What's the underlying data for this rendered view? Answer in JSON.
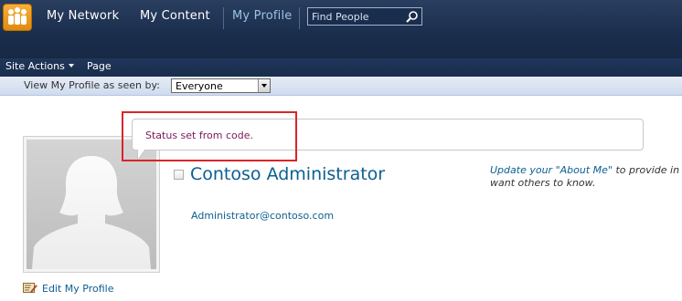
{
  "topnav": {
    "links": [
      {
        "label": "My Network"
      },
      {
        "label": "My Content"
      },
      {
        "label": "My Profile",
        "active": true
      }
    ],
    "search_placeholder": "Find People"
  },
  "ribbon": {
    "site_actions": "Site Actions",
    "page": "Page"
  },
  "view_as": {
    "label": "View My Profile as seen by:",
    "selected": "Everyone"
  },
  "status": {
    "text": "Status set from code."
  },
  "profile": {
    "name": "Contoso Administrator",
    "email": "Administrator@contoso.com",
    "about_link": "Update your \"About Me\"",
    "about_rest": " to provide in",
    "about_line2": "want others to know.",
    "edit_label": "Edit My Profile"
  },
  "colors": {
    "nav_background": "#1a2d4c",
    "link_blue": "#0b5f91",
    "status_text": "#7a1a5a",
    "highlight": "#d8262b"
  }
}
